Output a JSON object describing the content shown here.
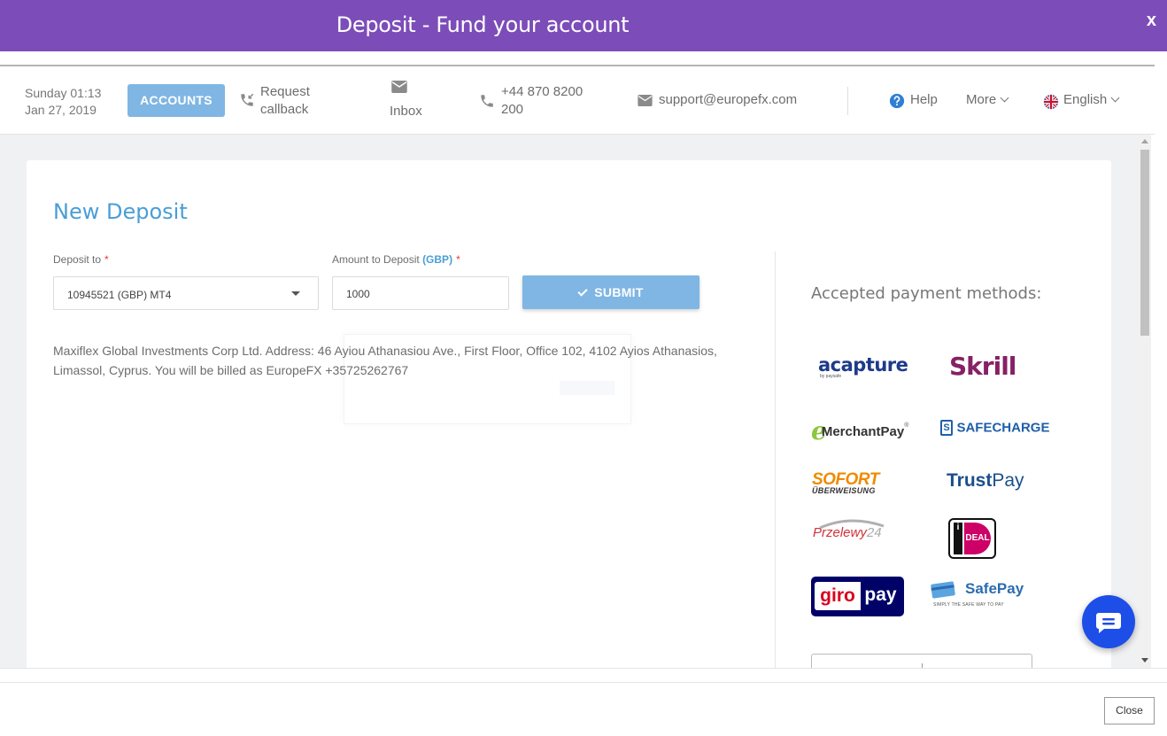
{
  "dialog": {
    "title": "Deposit - Fund your account",
    "close_glyph": "x"
  },
  "topbar": {
    "day_time": "Sunday 01:13",
    "date": "Jan 27, 2019",
    "accounts_label": "ACCOUNTS",
    "callback_line1": "Request",
    "callback_line2": "callback",
    "inbox_label": "Inbox",
    "phone_line1": "+44 870 8200",
    "phone_line2": "200",
    "email": "support@europefx.com",
    "help_label": "Help",
    "more_label": "More",
    "language_label": "English",
    "icons": [
      "phone-callback-icon",
      "mail-icon",
      "phone-icon",
      "mail-icon",
      "help-circle-icon",
      "chevron-down-icon",
      "uk-flag-icon"
    ]
  },
  "form": {
    "heading": "New Deposit",
    "deposit_to_label": "Deposit to",
    "required_mark": "*",
    "account_selected": "10945521 (GBP) MT4",
    "amount_label": "Amount to Deposit",
    "currency": "(GBP)",
    "amount_value": "1000",
    "submit_label": "SUBMIT",
    "address": "Maxiflex Global Investments Corp Ltd. Address: 46 Ayiou Athanasiou Ave., First Floor, Office 102, 4102 Ayios Athanasios, Limassol, Cyprus. You will be billed as EuropeFX +35725262767"
  },
  "payment_methods": {
    "title": "Accepted payment methods:",
    "logos": {
      "acapture": "acapture",
      "acapture_sub": "by paysafe",
      "skrill": "Skrill",
      "emerchantpay_e": "e",
      "emerchantpay_rest": "MerchantPay",
      "emerchantpay_mark": "®",
      "safecharge_mark": "S",
      "safecharge": "SAFECHARGE",
      "sofort": "SOFORT",
      "sofort_sub": "ÜBERWEISUNG",
      "trustpay_bold": "Trust",
      "trustpay_light": "Pay",
      "przelewy": "Przelewy",
      "przelewy_num": "24",
      "ideal_i": "i",
      "ideal_text": "DEAL",
      "giropay_giro": "giro",
      "giropay_pay": "pay",
      "safepay": "SafePay",
      "safepay_sub": "SIMPLY THE SAFE WAY TO PAY"
    },
    "brand_colors": {
      "acapture": "#1e3a8a",
      "skrill": "#862165",
      "emerchantpay": "#8dc63f",
      "safecharge": "#1f5fa8",
      "sofort": "#ef8b00",
      "trustpay": "#1b4f8c",
      "przelewy": "#d13239",
      "ideal": "#cc0066",
      "giropay": "#000268",
      "safepay": "#2b6cb0"
    }
  },
  "footer": {
    "close_label": "Close"
  },
  "colors": {
    "title_bar": "#7c4db8",
    "accent_blue": "#4a9ed6",
    "button_blue": "#7fb6e3",
    "chat_button": "#1d4ee8",
    "required": "#e53935"
  }
}
